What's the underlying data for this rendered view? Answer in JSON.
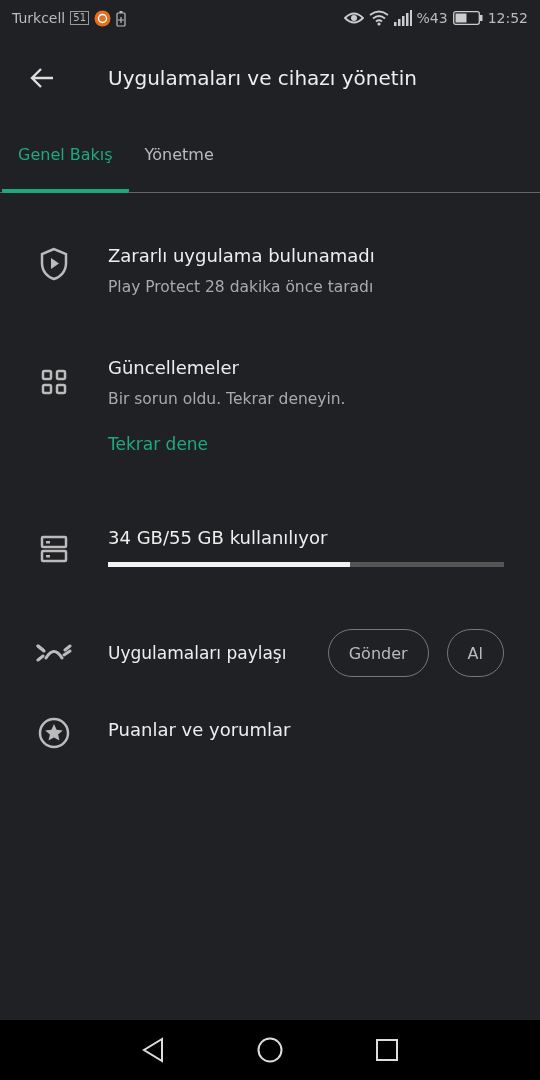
{
  "status_bar": {
    "carrier": "Turkcell",
    "sim_label": "51",
    "battery_percent": "%43",
    "time": "12:52"
  },
  "header": {
    "title": "Uygulamaları ve cihazı yönetin"
  },
  "tabs": [
    {
      "label": "Genel Bakış",
      "selected": true
    },
    {
      "label": "Yönetme",
      "selected": false
    }
  ],
  "items": [
    {
      "kind": "protect",
      "title": "Zararlı uygulama bulunamadı",
      "subtitle": "Play Protect 28 dakika önce taradı"
    },
    {
      "kind": "updates",
      "title": "Güncellemeler",
      "subtitle": "Bir sorun oldu. Tekrar deneyin.",
      "link": "Tekrar dene"
    },
    {
      "kind": "storage",
      "title": "34 GB/55 GB kullanılıyor",
      "level": 0.61
    },
    {
      "kind": "share",
      "title": "Uygulamaları paylaşı",
      "buttons": [
        "Gönder",
        "Al"
      ]
    },
    {
      "kind": "ratings",
      "title": "Puanlar ve yorumlar"
    }
  ]
}
